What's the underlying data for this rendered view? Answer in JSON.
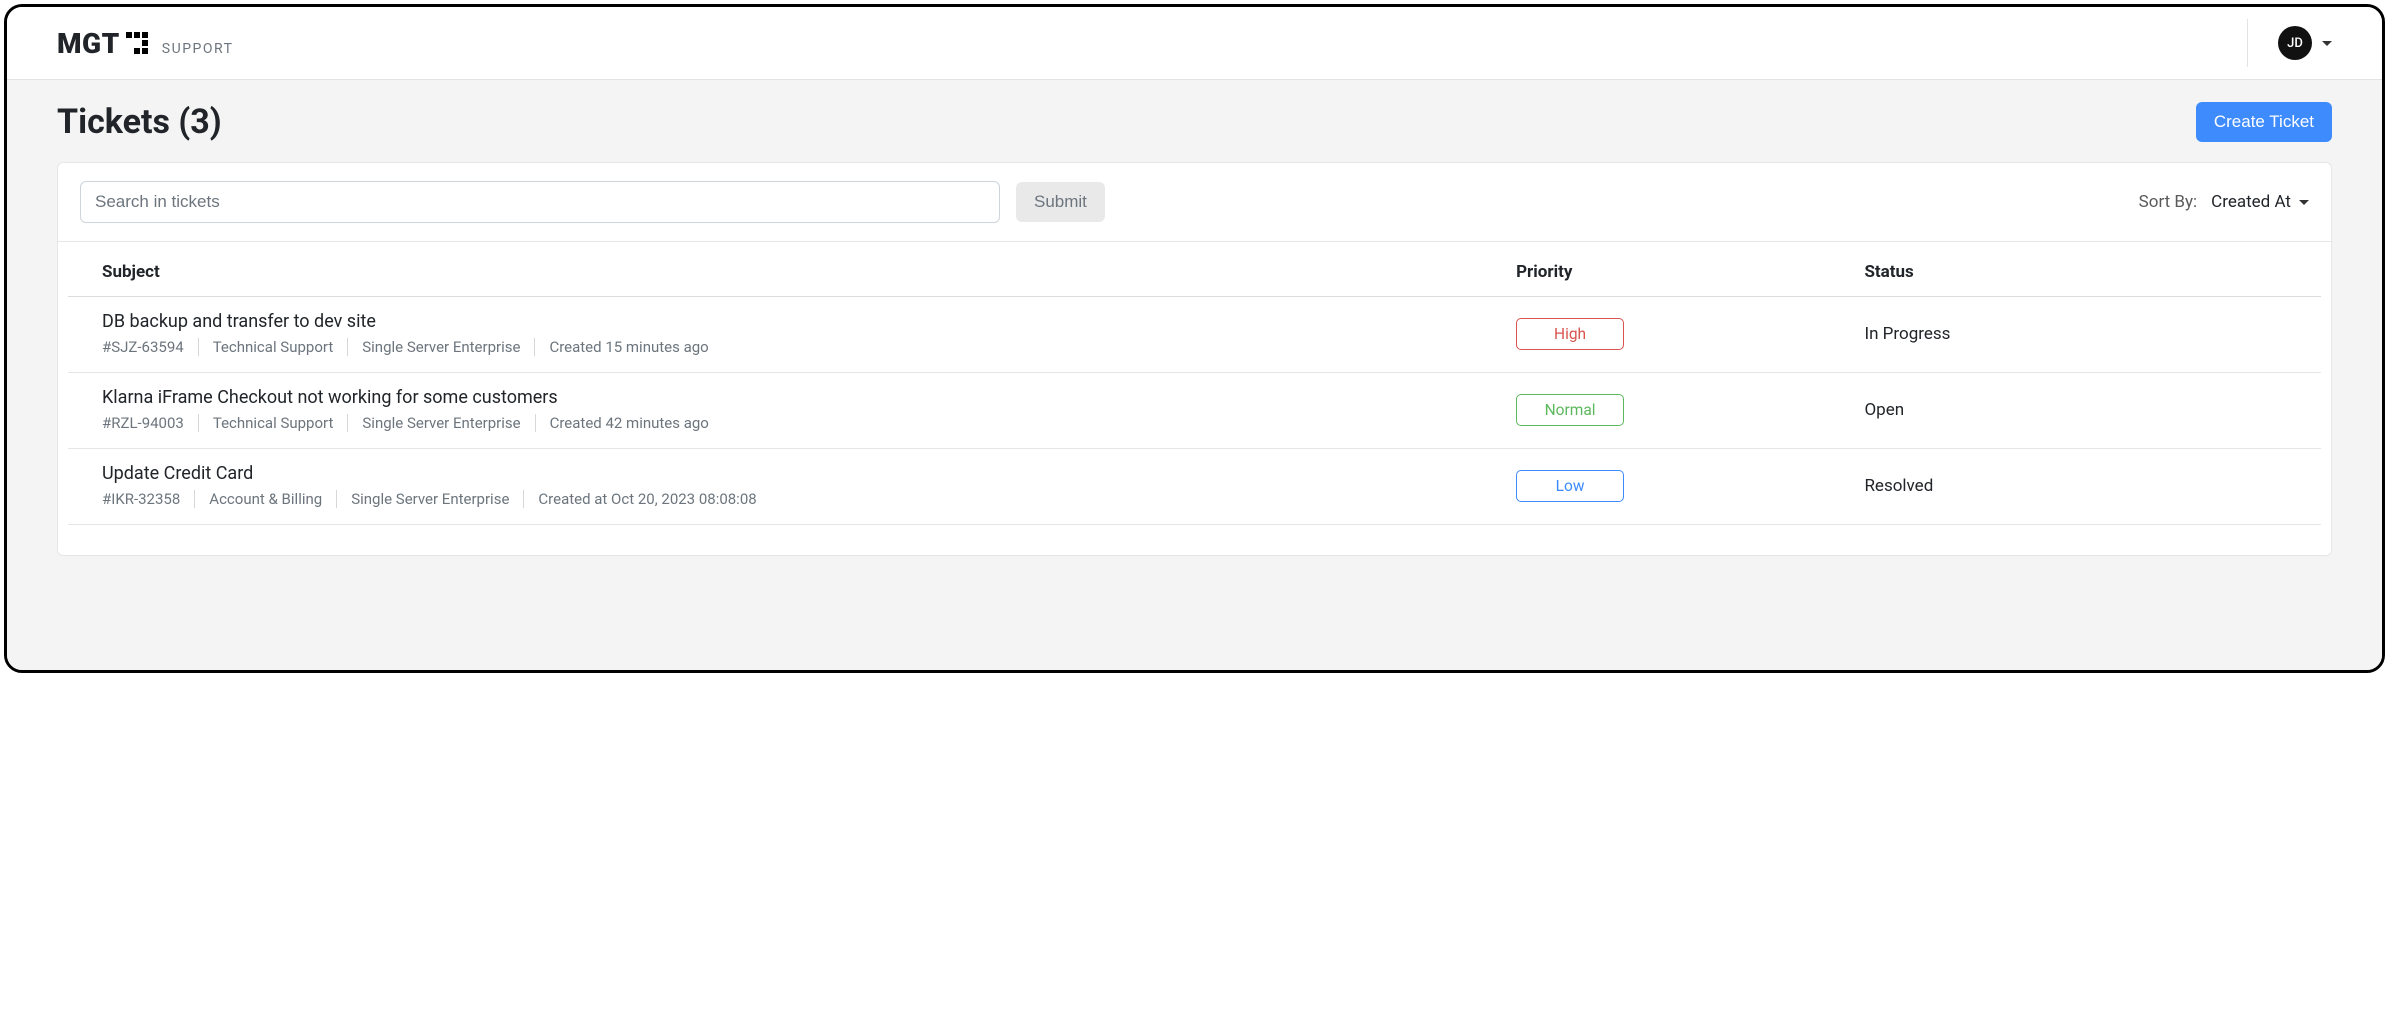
{
  "brand": {
    "name": "MGT",
    "sub": "SUPPORT"
  },
  "user": {
    "initials": "JD"
  },
  "page": {
    "title": "Tickets (3)"
  },
  "actions": {
    "create_label": "Create Ticket",
    "submit_label": "Submit"
  },
  "search": {
    "placeholder": "Search in tickets",
    "value": ""
  },
  "sort": {
    "label": "Sort By:",
    "value": "Created At"
  },
  "columns": {
    "subject": "Subject",
    "priority": "Priority",
    "status": "Status"
  },
  "tickets": [
    {
      "subject": "DB backup and transfer to dev site",
      "id": "#SJZ-63594",
      "category": "Technical Support",
      "plan": "Single Server Enterprise",
      "created": "Created 15 minutes ago",
      "priority": "High",
      "priority_class": "prio-high",
      "status": "In Progress"
    },
    {
      "subject": "Klarna iFrame Checkout not working for some customers",
      "id": "#RZL-94003",
      "category": "Technical Support",
      "plan": "Single Server Enterprise",
      "created": "Created 42 minutes ago",
      "priority": "Normal",
      "priority_class": "prio-normal",
      "status": "Open"
    },
    {
      "subject": "Update Credit Card",
      "id": "#IKR-32358",
      "category": "Account & Billing",
      "plan": "Single Server Enterprise",
      "created": "Created at Oct 20, 2023 08:08:08",
      "priority": "Low",
      "priority_class": "prio-low",
      "status": "Resolved"
    }
  ]
}
